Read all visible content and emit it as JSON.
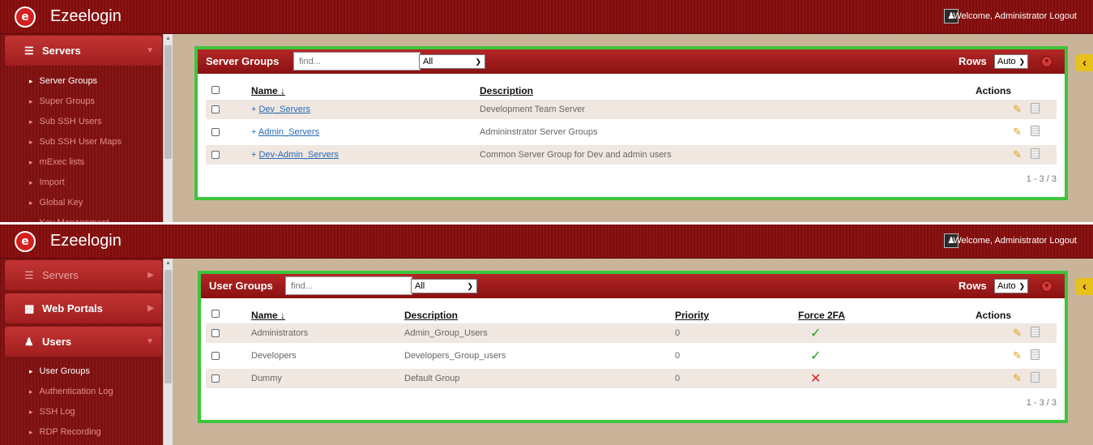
{
  "colors": {
    "header_red": "#8c1313",
    "panel_border_green": "#3dc43d",
    "link_blue": "#2a6ab8",
    "tab_yellow": "#e6c21a"
  },
  "icons": [
    "logo-icon",
    "user-icon",
    "list-icon",
    "portal-icon",
    "users-icon",
    "pencil-icon",
    "trash-icon",
    "check-icon",
    "cross-icon",
    "chevron-left-icon"
  ],
  "screen1": {
    "app_title": "Ezeelogin",
    "welcome": "Welcome, Administrator Logout",
    "sidebar": {
      "servers_label": "Servers",
      "items": [
        "Server Groups",
        "Super Groups",
        "Sub SSH Users",
        "Sub SSH User Maps",
        "mExec lists",
        "Import",
        "Global Key",
        "Key Management"
      ]
    },
    "panel": {
      "title": "Server Groups",
      "search_placeholder": "find...",
      "filter_value": "All",
      "rows_label": "Rows",
      "rows_value": "Auto",
      "columns": {
        "name": "Name ↓",
        "description": "Description",
        "actions": "Actions"
      },
      "rows": [
        {
          "prefix": "+ ",
          "name": "Dev_Servers",
          "description": "Development Team Server"
        },
        {
          "prefix": "+ ",
          "name": "Admin_Servers",
          "description": "Admininstrator Server Groups"
        },
        {
          "prefix": "+ ",
          "name": "Dev-Admin_Servers",
          "description": "Common Server Group for Dev and admin users"
        }
      ],
      "pagination": "1 - 3 / 3"
    }
  },
  "screen2": {
    "app_title": "Ezeelogin",
    "welcome": "Welcome, Administrator Logout",
    "sidebar": {
      "servers_label": "Servers",
      "web_portals_label": "Web Portals",
      "users_label": "Users",
      "items": [
        "User Groups",
        "Authentication Log",
        "SSH Log",
        "RDP Recording"
      ]
    },
    "panel": {
      "title": "User Groups",
      "search_placeholder": "find...",
      "filter_value": "All",
      "rows_label": "Rows",
      "rows_value": "Auto",
      "columns": {
        "name": "Name ↓",
        "description": "Description",
        "priority": "Priority",
        "force2fa": "Force 2FA",
        "actions": "Actions"
      },
      "rows": [
        {
          "name": "Administrators",
          "description": "Admin_Group_Users",
          "priority": "0",
          "force2fa": "✓"
        },
        {
          "name": "Developers",
          "description": "Developers_Group_users",
          "priority": "0",
          "force2fa": "✓"
        },
        {
          "name": "Dummy",
          "description": "Default Group",
          "priority": "0",
          "force2fa": "✕"
        }
      ],
      "pagination": "1 - 3 / 3"
    }
  }
}
